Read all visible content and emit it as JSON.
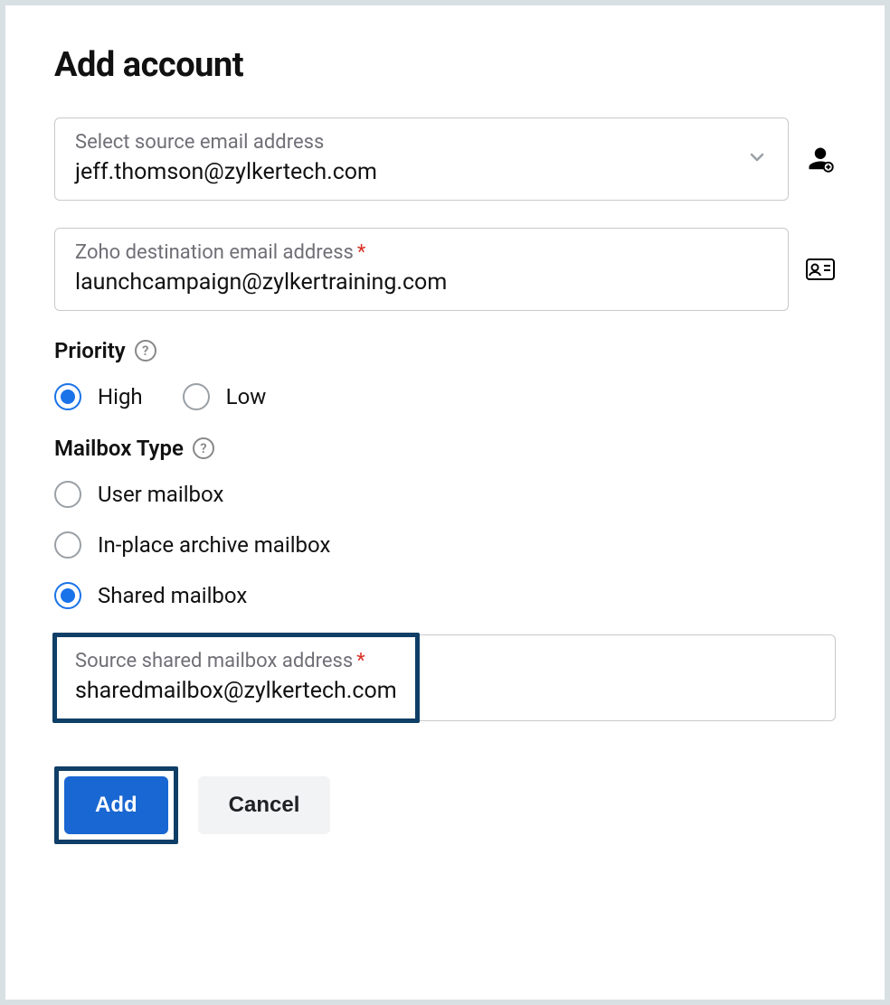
{
  "title": "Add account",
  "source": {
    "label": "Select source email address",
    "value": "jeff.thomson@zylkertech.com"
  },
  "destination": {
    "label": "Zoho destination email address",
    "required": "*",
    "value": "launchcampaign@zylkertraining.com"
  },
  "priority": {
    "label": "Priority",
    "options": {
      "high": "High",
      "low": "Low"
    },
    "selected": "high"
  },
  "mailboxType": {
    "label": "Mailbox Type",
    "options": {
      "user": "User mailbox",
      "archive": "In-place archive mailbox",
      "shared": "Shared mailbox"
    },
    "selected": "shared"
  },
  "sharedMailbox": {
    "label": "Source shared mailbox address",
    "required": "*",
    "value": "sharedmailbox@zylkertech.com"
  },
  "buttons": {
    "add": "Add",
    "cancel": "Cancel"
  }
}
